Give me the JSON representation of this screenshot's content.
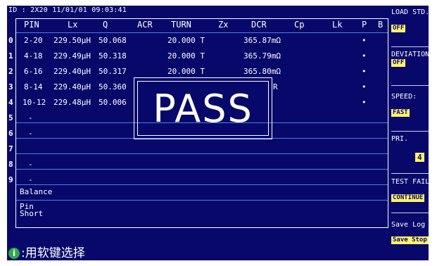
{
  "title": "ID : 2X20   11/01/01   09:03:41",
  "headers": [
    "PIN",
    "Lx",
    "Q",
    "ACR",
    "TURN",
    "Zx",
    "DCR",
    "Cp",
    "Lk",
    "P",
    "B"
  ],
  "rows": [
    {
      "num": "0",
      "pin": "2-20",
      "lx": "229.50μH",
      "q": "50.068",
      "turn": "20.000 T",
      "dcr": "365.87mΩ",
      "p": "•"
    },
    {
      "num": "1",
      "pin": "4-18",
      "lx": "229.49μH",
      "q": "50.318",
      "turn": "20.000 T",
      "dcr": "365.79mΩ",
      "p": "•"
    },
    {
      "num": "2",
      "pin": "6-16",
      "lx": "229.40μH",
      "q": "50.317",
      "turn": "20.000 T",
      "dcr": "365.80mΩ",
      "p": "•"
    },
    {
      "num": "3",
      "pin": "8-14",
      "lx": "229.40μH",
      "q": "50.360",
      "turn": "",
      "dcr": "R",
      "p": "•"
    },
    {
      "num": "4",
      "pin": "10-12",
      "lx": "229.48μH",
      "q": "50.006",
      "turn": "",
      "dcr": "",
      "p": "•"
    },
    {
      "num": "5",
      "pin": "-",
      "lx": "",
      "q": "",
      "turn": "",
      "dcr": "",
      "p": ""
    },
    {
      "num": "6",
      "pin": "-",
      "lx": "",
      "q": "",
      "turn": "",
      "dcr": "",
      "p": ""
    },
    {
      "num": "7",
      "pin": "",
      "lx": "",
      "q": "",
      "turn": "",
      "dcr": "",
      "p": ""
    },
    {
      "num": "8",
      "pin": "-",
      "lx": "",
      "q": "",
      "turn": "",
      "dcr": "",
      "p": ""
    },
    {
      "num": "9",
      "pin": "-",
      "lx": "",
      "q": "",
      "turn": "",
      "dcr": "",
      "p": ""
    }
  ],
  "balance_label": "Balance",
  "pin_label": "Pin",
  "short_label": "Short",
  "pass_text": "PASS",
  "footer_text": ":用软键选择",
  "sidebar": {
    "load_std_label": "LOAD STD.",
    "load_std_value": "OFF",
    "deviation_label": "DEVIATION",
    "deviation_value": "OFF",
    "speed_label": "SPEED:",
    "speed_value": "FAST",
    "pri_label": "PRI.",
    "pri_value": "4",
    "test_fail_label": "TEST FAIL",
    "test_fail_value": "CONTINUE",
    "save_log_label": "Save Log",
    "save_stop_label": "Save Stop"
  }
}
